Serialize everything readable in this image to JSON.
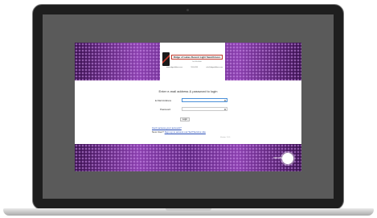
{
  "site": {
    "logo_title": "Ridge of Lakes Decent Light Swarthmore",
    "logo_sub": "Tel 555-0100",
    "contacts": [
      "www.ridgeoflakes.com",
      "555-0199",
      "info@ridgeoflakes.com"
    ],
    "heading": "Enter e-mail address & password to login",
    "email_label": "E-Mail Address",
    "password_label": "Password",
    "login_label": "Login",
    "link_line1_prefix": "",
    "link_line1_link": "Can't access your account?",
    "link_line2_prefix": "New User? ",
    "link_line2_link": "Sign up to access our Self Service site",
    "version": "Version: 1.0.0",
    "brand": "salesforce"
  },
  "icons": {
    "email_field_icon": "key-icon",
    "password_field_icon": "key-icon",
    "brand_logo": "brand-logo-icon"
  },
  "colors": {
    "band": "#4a1f63",
    "band_highlight": "#8a3fae",
    "link": "#2a4fb8",
    "logo_accent": "#c0392b"
  }
}
